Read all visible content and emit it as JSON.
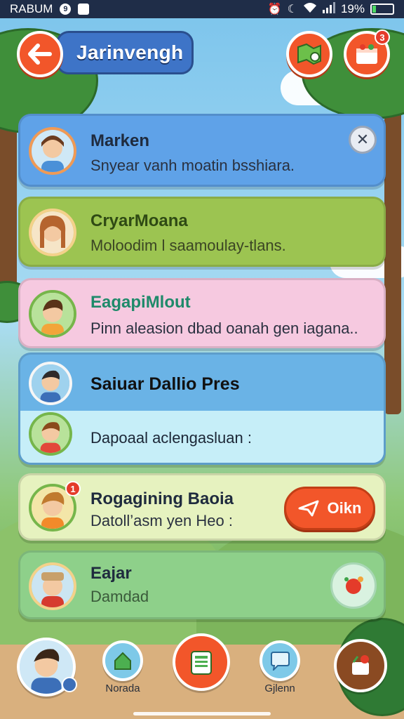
{
  "status_bar": {
    "carrier": "RABUM",
    "notification_count": "9",
    "battery": "19%",
    "battery_level": 0.19
  },
  "header": {
    "title": "Jarinvengh",
    "notification_badge": "3"
  },
  "messages": [
    {
      "name": "Marken",
      "text": "Snyear vanh moatin bsshiara.",
      "color": "#5fa2e8"
    },
    {
      "name": "CryarMoana",
      "text": "Moloodim l saamoulay-tlans.",
      "color": "#9cc451"
    },
    {
      "name": "EagapiMlout",
      "text": "Pinn aleasion dbad oanah gen iagana..",
      "color": "#f6c9e0"
    },
    {
      "name": "Saiuar Dallio Pres",
      "text": "",
      "color": "#6ab3e6"
    },
    {
      "name": "",
      "text": "Dapoaal aclengasluan :",
      "color": "#c6eef8"
    },
    {
      "name": "Rogagining Baoia",
      "text": "Datoll’asm yen Heo :",
      "color": "#e6f2bf",
      "badge": "1",
      "action_label": "Oikn"
    },
    {
      "name": "Eajar",
      "text": "Damdad",
      "color": "#8ed08a"
    }
  ],
  "nav": {
    "items": [
      {
        "label": ""
      },
      {
        "label": "Norada"
      },
      {
        "label": ""
      },
      {
        "label": "Gjlenn"
      },
      {
        "label": ""
      }
    ]
  },
  "colors": {
    "accent": "#f2562a",
    "header_pill": "#3e74c7",
    "status_bar": "#1f2d48"
  }
}
